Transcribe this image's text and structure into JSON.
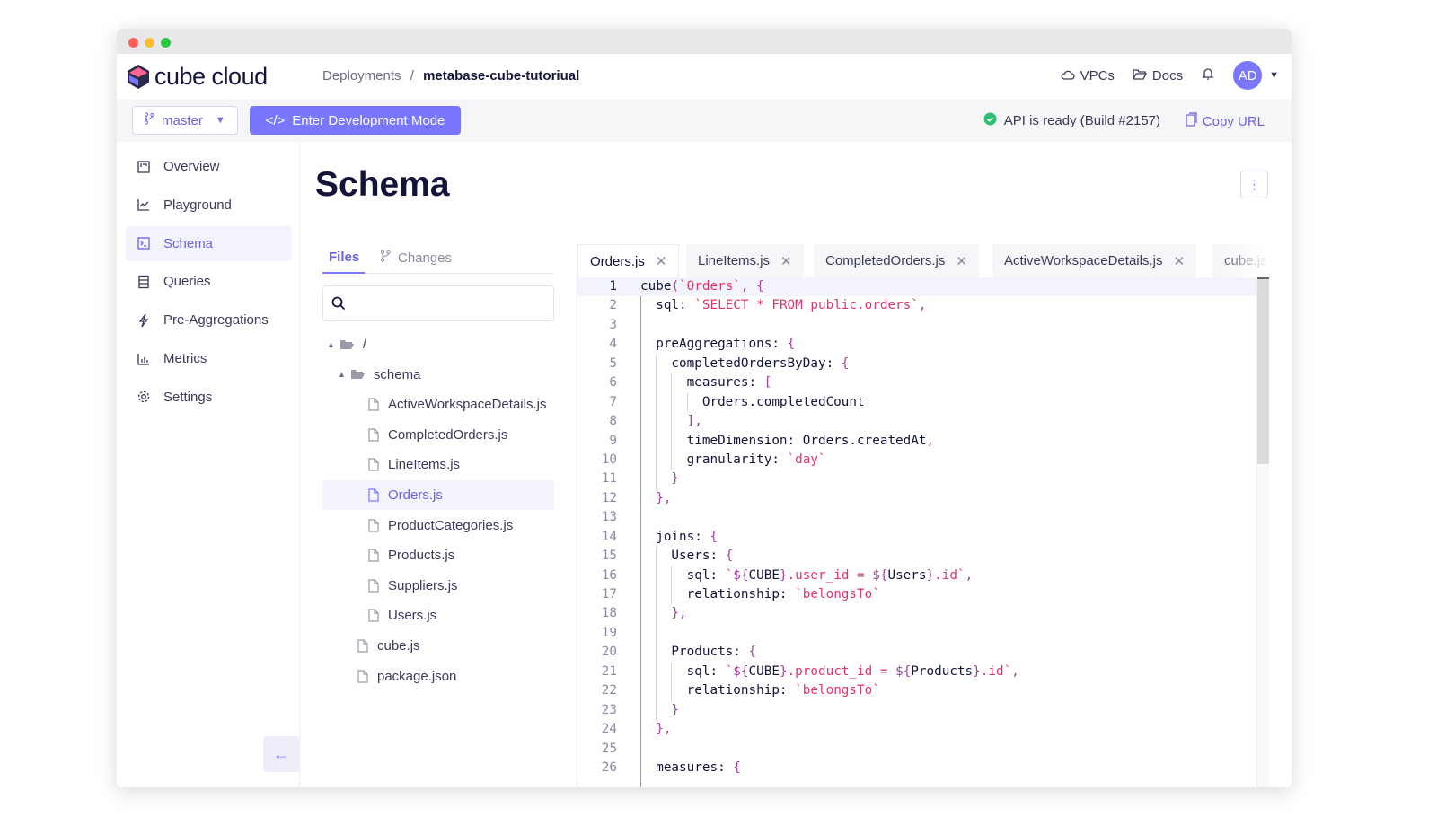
{
  "app": {
    "brand": "cube cloud",
    "accent": "#7a77ff"
  },
  "breadcrumb": {
    "parent": "Deployments",
    "separator": "/",
    "current": "metabase-cube-tutoriual"
  },
  "header": {
    "vpcs": "VPCs",
    "docs": "Docs",
    "avatar": "AD"
  },
  "toolbar": {
    "branch": "master",
    "dev_mode": "Enter Development Mode",
    "dev_icon": "</>",
    "status": "API is ready (Build #2157)",
    "copy_url": "Copy URL"
  },
  "sidebar": {
    "items": [
      {
        "label": "Overview",
        "icon": "overview-icon"
      },
      {
        "label": "Playground",
        "icon": "chart-line-icon"
      },
      {
        "label": "Schema",
        "icon": "terminal-icon",
        "active": true
      },
      {
        "label": "Queries",
        "icon": "list-icon"
      },
      {
        "label": "Pre-Aggregations",
        "icon": "lightning-icon"
      },
      {
        "label": "Metrics",
        "icon": "bar-chart-icon"
      },
      {
        "label": "Settings",
        "icon": "gear-icon"
      }
    ]
  },
  "page": {
    "title": "Schema"
  },
  "files": {
    "tabs": [
      "Files",
      "Changes"
    ],
    "search_placeholder": "",
    "tree": [
      {
        "name": "/",
        "type": "folder",
        "depth": 0
      },
      {
        "name": "schema",
        "type": "folder",
        "depth": 1
      },
      {
        "name": "ActiveWorkspaceDetails.js",
        "type": "file",
        "depth": 2
      },
      {
        "name": "CompletedOrders.js",
        "type": "file",
        "depth": 2
      },
      {
        "name": "LineItems.js",
        "type": "file",
        "depth": 2
      },
      {
        "name": "Orders.js",
        "type": "file",
        "depth": 2,
        "selected": true
      },
      {
        "name": "ProductCategories.js",
        "type": "file",
        "depth": 2
      },
      {
        "name": "Products.js",
        "type": "file",
        "depth": 2
      },
      {
        "name": "Suppliers.js",
        "type": "file",
        "depth": 2
      },
      {
        "name": "Users.js",
        "type": "file",
        "depth": 2
      },
      {
        "name": "cube.js",
        "type": "file",
        "depth": 1
      },
      {
        "name": "package.json",
        "type": "file",
        "depth": 1
      }
    ]
  },
  "editor": {
    "tabs": [
      {
        "label": "Orders.js",
        "active": true
      },
      {
        "label": "LineItems.js"
      },
      {
        "label": "CompletedOrders.js"
      },
      {
        "label": "ActiveWorkspaceDetails.js"
      },
      {
        "label": "cube.js"
      }
    ],
    "current_line": 1,
    "lines": [
      [
        [
          "t",
          "cube"
        ],
        [
          "p",
          "("
        ],
        [
          "s",
          "`Orders`"
        ],
        [
          "p",
          ", {"
        ]
      ],
      [
        [
          "t",
          "  sql: "
        ],
        [
          "s",
          "`SELECT * FROM public.orders`"
        ],
        [
          "p",
          ","
        ]
      ],
      [],
      [
        [
          "t",
          "  preAggregations: "
        ],
        [
          "p",
          "{"
        ]
      ],
      [
        [
          "t",
          "    completedOrdersByDay: "
        ],
        [
          "p",
          "{"
        ]
      ],
      [
        [
          "t",
          "      measures: "
        ],
        [
          "p",
          "["
        ]
      ],
      [
        [
          "t",
          "        Orders.completedCount"
        ]
      ],
      [
        [
          "p",
          "      ],"
        ]
      ],
      [
        [
          "t",
          "      timeDimension: Orders.createdAt"
        ],
        [
          "p",
          ","
        ]
      ],
      [
        [
          "t",
          "      granularity: "
        ],
        [
          "s",
          "`day`"
        ]
      ],
      [
        [
          "p",
          "    }"
        ]
      ],
      [
        [
          "p",
          "  },"
        ]
      ],
      [],
      [
        [
          "t",
          "  joins: "
        ],
        [
          "p",
          "{"
        ]
      ],
      [
        [
          "t",
          "    Users: "
        ],
        [
          "p",
          "{"
        ]
      ],
      [
        [
          "t",
          "      sql: "
        ],
        [
          "s",
          "`"
        ],
        [
          "p",
          "${"
        ],
        [
          "t",
          "CUBE"
        ],
        [
          "p",
          "}"
        ],
        [
          "s",
          ".user_id = "
        ],
        [
          "p",
          "${"
        ],
        [
          "t",
          "Users"
        ],
        [
          "p",
          "}"
        ],
        [
          "s",
          ".id`"
        ],
        [
          "p",
          ","
        ]
      ],
      [
        [
          "t",
          "      relationship: "
        ],
        [
          "s",
          "`belongsTo`"
        ]
      ],
      [
        [
          "p",
          "    },"
        ]
      ],
      [],
      [
        [
          "t",
          "    Products: "
        ],
        [
          "p",
          "{"
        ]
      ],
      [
        [
          "t",
          "      sql: "
        ],
        [
          "s",
          "`"
        ],
        [
          "p",
          "${"
        ],
        [
          "t",
          "CUBE"
        ],
        [
          "p",
          "}"
        ],
        [
          "s",
          ".product_id = "
        ],
        [
          "p",
          "${"
        ],
        [
          "t",
          "Products"
        ],
        [
          "p",
          "}"
        ],
        [
          "s",
          ".id`"
        ],
        [
          "p",
          ","
        ]
      ],
      [
        [
          "t",
          "      relationship: "
        ],
        [
          "s",
          "`belongsTo`"
        ]
      ],
      [
        [
          "p",
          "    }"
        ]
      ],
      [
        [
          "p",
          "  },"
        ]
      ],
      [],
      [
        [
          "t",
          "  measures: "
        ],
        [
          "p",
          "{"
        ]
      ]
    ]
  }
}
